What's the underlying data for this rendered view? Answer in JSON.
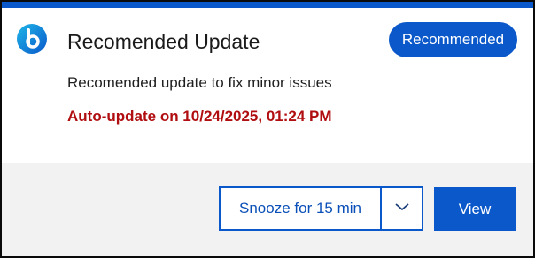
{
  "notification": {
    "title": "Recomended Update",
    "badge": "Recommended",
    "description": "Recomended update to fix minor issues",
    "auto_update": "Auto-update on 10/24/2025, 01:24 PM"
  },
  "actions": {
    "snooze_label": "Snooze for 15 min",
    "view_label": "View"
  },
  "icons": {
    "app_logo": "app-logo-icon",
    "dropdown": "chevron-down-icon"
  },
  "colors": {
    "accent": "#0a58ca",
    "warning_text": "#b00e10",
    "footer_bg": "#f2f2f2"
  }
}
